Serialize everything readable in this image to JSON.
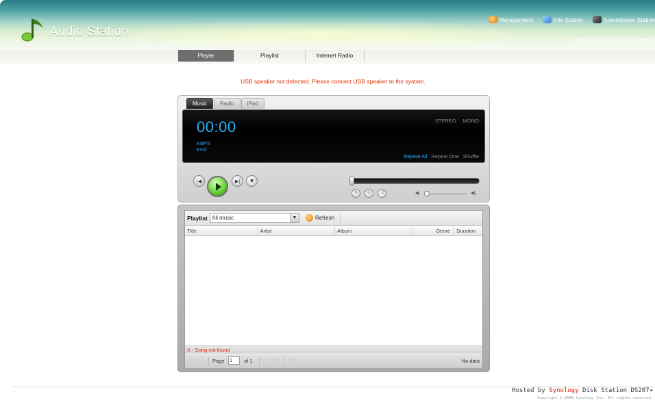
{
  "app": {
    "title": "Audio Station"
  },
  "top_links": [
    {
      "label": "Management",
      "icon": "management-icon"
    },
    {
      "label": "File Station",
      "icon": "file-station-icon"
    },
    {
      "label": "Surveillance Station",
      "icon": "surveillance-icon"
    }
  ],
  "welcome": {
    "text": "Welcome admin",
    "help": "Help",
    "logout": "Logout",
    "separator": "|"
  },
  "tabs": [
    {
      "label": "Player",
      "active": true
    },
    {
      "label": "Playlist",
      "active": false
    },
    {
      "label": "Internet Radio",
      "active": false
    }
  ],
  "warning": "USB speaker not detected. Please connect USB speaker to the system.",
  "player": {
    "tabs": [
      "Music",
      "Radio",
      "iPod"
    ],
    "active_tab": "Music",
    "time": "00:00",
    "kbps_label": "KBPS",
    "khz_label": "KHZ",
    "stereo": "STEREO",
    "mono": "MONO",
    "repeat_all": "Repeat All",
    "repeat_one": "Repeat One",
    "shuffle": "Shuffle",
    "progress": 0,
    "volume": 0.05
  },
  "playlist": {
    "label": "Playlist",
    "selected": "All music",
    "refresh": "Refresh",
    "columns": [
      "Title",
      "Artist",
      "Album",
      "Genre",
      "Duration"
    ],
    "status": "X - Song not found",
    "page_label": "Page",
    "page_value": "1",
    "page_of": "of 1",
    "no_data": "No data"
  },
  "footer": {
    "hosted_prefix": "Hosted by",
    "brand": "Synology",
    "product": "Disk Station DS207+",
    "copyright": "Copyright © 2008 Synology Inc. All rights reserved."
  },
  "colors": {
    "accent_blue": "#2ab6ff",
    "warning_red": "#e03000",
    "brand_red": "#cc2200",
    "play_green": "#6ed33a"
  }
}
